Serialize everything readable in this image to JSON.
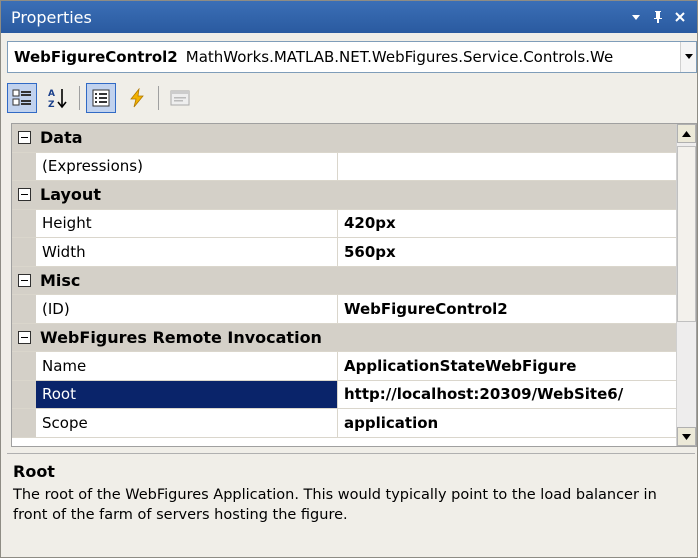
{
  "window": {
    "title": "Properties"
  },
  "object_selector": {
    "name": "WebFigureControl2",
    "type": "MathWorks.MATLAB.NET.WebFigures.Service.Controls.We"
  },
  "toolbar": {
    "buttons": [
      "categorized-icon",
      "alphabetical-icon",
      "properties-icon",
      "events-icon",
      "property-pages-icon"
    ]
  },
  "grid": {
    "categories": [
      {
        "label": "Data",
        "rows": [
          {
            "name": "(Expressions)",
            "value": ""
          }
        ]
      },
      {
        "label": "Layout",
        "rows": [
          {
            "name": "Height",
            "value": "420px"
          },
          {
            "name": "Width",
            "value": "560px"
          }
        ]
      },
      {
        "label": "Misc",
        "rows": [
          {
            "name": "(ID)",
            "value": "WebFigureControl2"
          }
        ]
      },
      {
        "label": "WebFigures Remote Invocation",
        "rows": [
          {
            "name": "Name",
            "value": "ApplicationStateWebFigure"
          },
          {
            "name": "Root",
            "value": "http://localhost:20309/WebSite6/"
          },
          {
            "name": "Scope",
            "value": "application"
          }
        ]
      }
    ],
    "selected_row": "Root"
  },
  "description": {
    "title": "Root",
    "text": "The root of the WebFigures Application.  This would typically point to the load balancer in front of the farm of servers hosting the figure."
  },
  "colors": {
    "titlebar": "#2a5aa0",
    "selection": "#0a246a",
    "category_bg": "#d4d0c8"
  }
}
